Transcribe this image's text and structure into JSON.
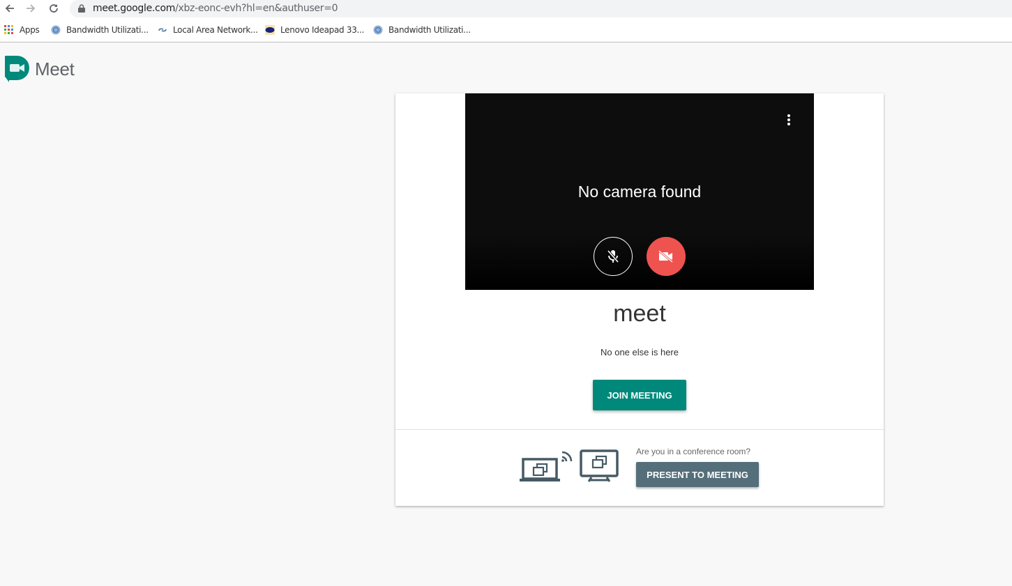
{
  "browser": {
    "url_host": "meet.google.com",
    "url_rest": "/xbz-eonc-evh?hl=en&authuser=0",
    "bookmarks": [
      {
        "label": "Apps",
        "icon": "apps-grid-icon"
      },
      {
        "label": "Bandwidth Utilizati...",
        "icon": "globe-icon"
      },
      {
        "label": "Local Area Network...",
        "icon": "network-link-icon"
      },
      {
        "label": "Lenovo Ideapad 33...",
        "icon": "vcs-logo-icon"
      },
      {
        "label": "Bandwidth Utilizati...",
        "icon": "globe-icon"
      }
    ]
  },
  "app": {
    "name": "Meet",
    "brand_color": "#00897b"
  },
  "preview": {
    "message": "No camera found",
    "mic_state": "muted",
    "camera_state": "off"
  },
  "meeting": {
    "title": "meet",
    "status": "No one else is here",
    "join_label": "JOIN MEETING",
    "conference_question": "Are you in a conference room?",
    "present_label": "PRESENT TO MEETING"
  }
}
